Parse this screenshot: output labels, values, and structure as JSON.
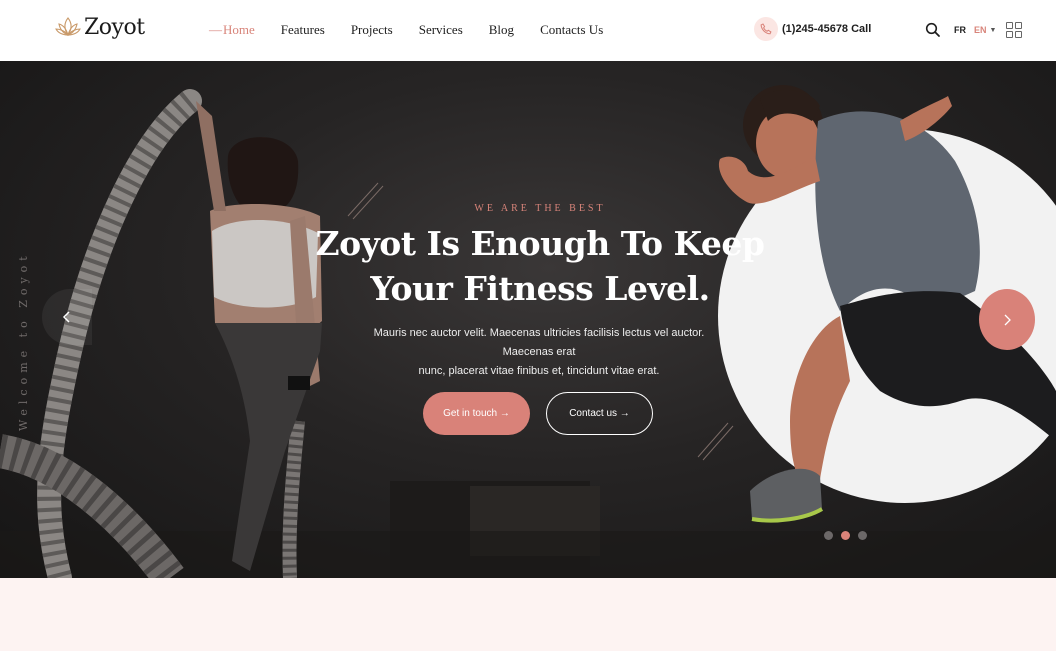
{
  "brand": {
    "name": "Zoyot"
  },
  "nav": {
    "items": [
      {
        "label": "Home",
        "active": true
      },
      {
        "label": "Features",
        "active": false
      },
      {
        "label": "Projects",
        "active": false
      },
      {
        "label": "Services",
        "active": false
      },
      {
        "label": "Blog",
        "active": false
      },
      {
        "label": "Contacts Us",
        "active": false
      }
    ]
  },
  "header": {
    "phone": "(1)245-45678 Call",
    "phone_icon": "phone-icon",
    "search_icon": "search-icon",
    "languages": {
      "fr": "FR",
      "en": "EN"
    },
    "menu_icon": "grid-menu-icon"
  },
  "hero": {
    "side_text": "Welcome to Zoyot",
    "eyebrow": "WE ARE THE BEST",
    "title_line1": "Zoyot Is Enough To Keep",
    "title_line2": "Your Fitness Level.",
    "description_line1": "Mauris nec auctor velit. Maecenas ultricies facilisis lectus vel auctor. Maecenas erat",
    "description_line2": "nunc, placerat vitae finibus et, tincidunt vitae erat.",
    "primary_button": "Get in touch →",
    "secondary_button": "Contact us →",
    "slider_dots": 3,
    "active_slide": 2
  },
  "colors": {
    "accent": "#d98279",
    "dark": "#1e1e1e",
    "hero_bg": "#262424",
    "page_bg": "#fdf3f2"
  }
}
